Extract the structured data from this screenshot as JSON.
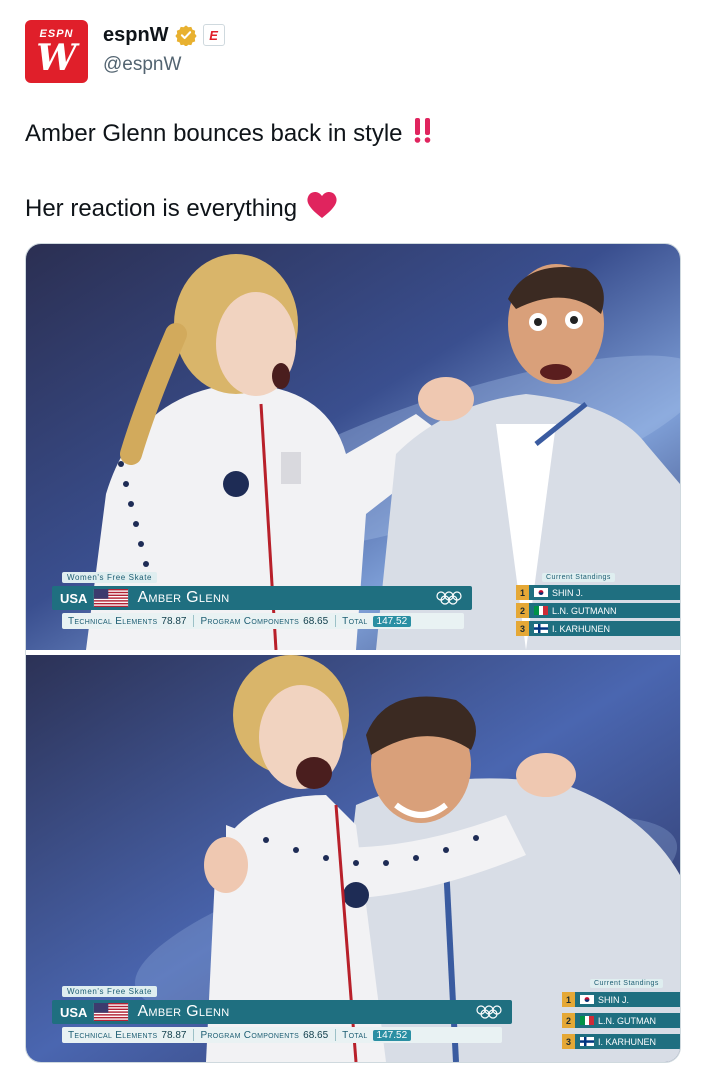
{
  "post": {
    "display_name": "espnW",
    "handle": "@espnW",
    "avatar_text": "ESPN",
    "avatar_mark": "W",
    "affiliate_badge": "E",
    "verified_icon": "verified-gold-check-icon",
    "line1": "Amber Glenn bounces back in style",
    "line1_emoji": "‼️",
    "line2": "Her reaction is everything",
    "line2_emoji": "❤️"
  },
  "graphic": {
    "event": "Women's Free Skate",
    "country": "USA",
    "skater": "Amber Glenn",
    "technical_label": "Technical Elements",
    "technical_value": "78.87",
    "program_label": "Program Components",
    "program_value": "68.65",
    "total_label": "Total",
    "total_value": "147.52",
    "standings_title": "Current Standings",
    "standings": [
      {
        "rank": "1",
        "name": "SHIN J."
      },
      {
        "rank": "2",
        "name": "L.N. GUTMANN"
      },
      {
        "rank": "3",
        "name": "I. KARHUNEN"
      }
    ]
  },
  "frame2_overrides": {
    "standings": [
      {
        "rank": "1",
        "name": "SHIN J."
      },
      {
        "rank": "2",
        "name": "L.N. GUTMAN"
      },
      {
        "rank": "3",
        "name": "I. KARHUNEN"
      }
    ]
  },
  "colors": {
    "espn_red": "#e01f2a",
    "graphic_teal": "#1f6f80",
    "rank_gold": "#e5a836",
    "heart_red": "#e0245e",
    "verified_gold": "#e8b130"
  }
}
